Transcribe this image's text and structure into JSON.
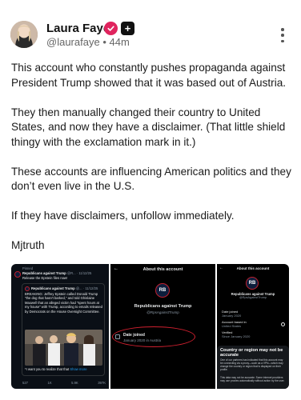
{
  "author": {
    "name": "Laura Faye",
    "handle": "@laurafaye",
    "time": "44m",
    "separator": "•",
    "check_badge_color": "#e0245e",
    "plus_badge_label": "+"
  },
  "post": {
    "paragraphs": [
      "This account who constantly pushes propaganda against President Trump showed that it was based out of Austria.",
      "They then manually changed their country to United States, and now they have a disclaimer. (That little shield thingy with the exclamation mark in it.)",
      "These accounts are influencing American politics and they don’t even live in the U.S.",
      "If they have disclaimers, unfollow immediately.",
      "Mjtruth"
    ]
  },
  "media": {
    "shot1": {
      "pinned": "Pinned",
      "account": "Republicans against Trump",
      "meta": "@R... · 11/12/25",
      "line": "Release the Epstein files now!",
      "quoted_account": "Republicans against Trump",
      "quoted_meta": "@... · 11/12/25",
      "quoted_text": "BREAKING: Jeffrey Epstein called Donald Trump \"the dog that hasn't barked,\" and told Ghislaine Maxwell that an alleged victim had \"spent hours at my house\" with Trump, according to emails released by Democrats on the House Oversight Committee.",
      "want_text": "*I want you to realize that that",
      "show_more": "Show more",
      "stats": [
        "527",
        "1K",
        "5.9K",
        "397K"
      ]
    },
    "shot2": {
      "title": "About this account",
      "account": "Republicans against Trump",
      "handle": "@RpsAgainstTrump",
      "date_label": "Date joined",
      "date_value": "January 2020 in Austria"
    },
    "shot3": {
      "title": "About this account",
      "account": "Republicans against Trump",
      "handle": "@RpsAgainstTrump",
      "rows": [
        {
          "label": "Date joined",
          "value": "January 2020"
        },
        {
          "label": "Account based in",
          "value": "United States"
        },
        {
          "label": "Verified",
          "value": "Since January 2020"
        }
      ],
      "notice_title": "Country or region may not be accurate",
      "notice_text": "One of our partners has indicated that this account may be connecting via a proxy—such as a VPN—which may change the country or region that is displayed on their profile.",
      "notice_text2": "This data may not be accurate. Some internet providers may use proxies automatically without action by the user."
    }
  }
}
